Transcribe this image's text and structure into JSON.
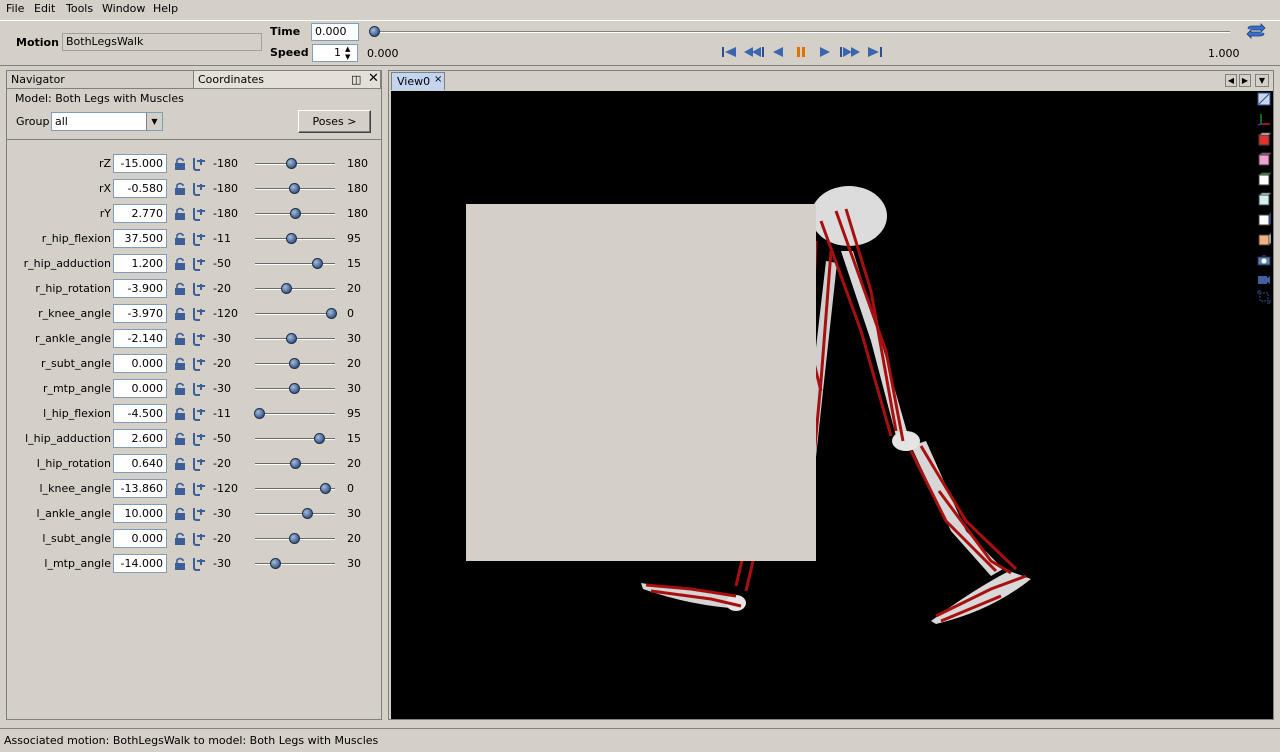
{
  "menubar": {
    "items": [
      "File",
      "Edit",
      "Tools",
      "Window",
      "Help"
    ]
  },
  "toolbar": {
    "motion_label": "Motion",
    "motion_value": "BothLegsWalk",
    "time_label": "Time",
    "time_value": "0.000",
    "speed_label": "Speed",
    "speed_value": "1",
    "range_start": "0.000",
    "range_end": "1.000",
    "time_fraction": 0
  },
  "navigator": {
    "tab_navigator": "Navigator",
    "tab_coordinates": "Coordinates",
    "model_label": "Model:  Both Legs with Muscles",
    "group_label": "Group",
    "group_value": "all",
    "poses_button": "Poses >"
  },
  "coordinates": [
    {
      "name": "rZ",
      "value": "-15.000",
      "min": "-180",
      "max": "180",
      "fraction": 0.458
    },
    {
      "name": "rX",
      "value": "-0.580",
      "min": "-180",
      "max": "180",
      "fraction": 0.498
    },
    {
      "name": "rY",
      "value": "2.770",
      "min": "-180",
      "max": "180",
      "fraction": 0.508
    },
    {
      "name": "r_hip_flexion",
      "value": "37.500",
      "min": "-11",
      "max": "95",
      "fraction": 0.458
    },
    {
      "name": "r_hip_adduction",
      "value": "1.200",
      "min": "-50",
      "max": "15",
      "fraction": 0.788
    },
    {
      "name": "r_hip_rotation",
      "value": "-3.900",
      "min": "-20",
      "max": "20",
      "fraction": 0.402
    },
    {
      "name": "r_knee_angle",
      "value": "-3.970",
      "min": "-120",
      "max": "0",
      "fraction": 0.967
    },
    {
      "name": "r_ankle_angle",
      "value": "-2.140",
      "min": "-30",
      "max": "30",
      "fraction": 0.464
    },
    {
      "name": "r_subt_angle",
      "value": "0.000",
      "min": "-20",
      "max": "20",
      "fraction": 0.5
    },
    {
      "name": "r_mtp_angle",
      "value": "0.000",
      "min": "-30",
      "max": "30",
      "fraction": 0.5
    },
    {
      "name": "l_hip_flexion",
      "value": "-4.500",
      "min": "-11",
      "max": "95",
      "fraction": 0.061
    },
    {
      "name": "l_hip_adduction",
      "value": "2.600",
      "min": "-50",
      "max": "15",
      "fraction": 0.809
    },
    {
      "name": "l_hip_rotation",
      "value": "0.640",
      "min": "-20",
      "max": "20",
      "fraction": 0.516
    },
    {
      "name": "l_knee_angle",
      "value": "-13.860",
      "min": "-120",
      "max": "0",
      "fraction": 0.885
    },
    {
      "name": "l_ankle_angle",
      "value": "10.000",
      "min": "-30",
      "max": "30",
      "fraction": 0.667
    },
    {
      "name": "l_subt_angle",
      "value": "0.000",
      "min": "-20",
      "max": "20",
      "fraction": 0.5
    },
    {
      "name": "l_mtp_angle",
      "value": "-14.000",
      "min": "-30",
      "max": "30",
      "fraction": 0.267
    }
  ],
  "view": {
    "tab_label": "View0"
  },
  "status": {
    "text": "Associated motion: BothLegsWalk to model: Both Legs with Muscles"
  }
}
